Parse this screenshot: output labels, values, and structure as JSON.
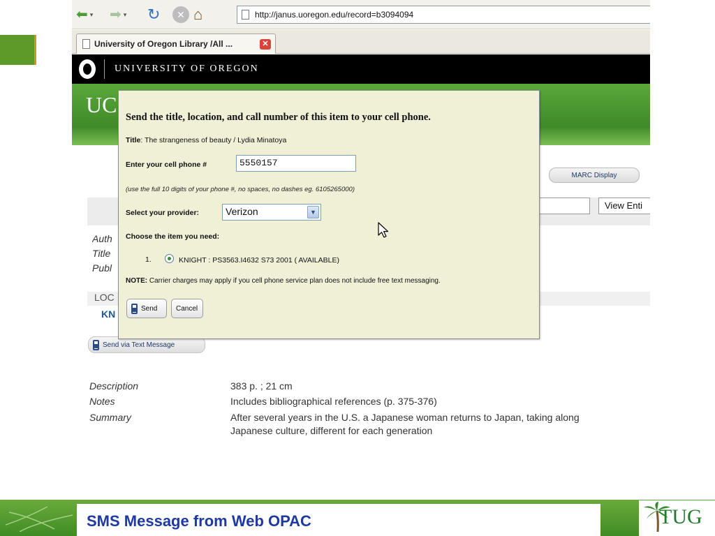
{
  "browser": {
    "url": "http://janus.uoregon.edu/record=b3094094",
    "tab_title": "University of Oregon Library /All ...",
    "tab_close_glyph": "✕",
    "back_glyph": "⬅",
    "forward_glyph": "➡",
    "dropdown_glyph": "▾",
    "refresh_glyph": "↻",
    "stop_glyph": "✕",
    "home_glyph": "⌂"
  },
  "site": {
    "university_name": "UNIVERSITY OF OREGON",
    "band_title_partial": "UC"
  },
  "record_page": {
    "marc_button": "MARC Display",
    "view_entire_button": "View Enti",
    "field_labels_partial": [
      "Auth",
      "Title",
      "Publ"
    ],
    "location_label_partial": "LOC",
    "location_value_partial": "KN",
    "send_text_button": "Send via Text Message",
    "details": [
      {
        "label": "Description",
        "value": "383 p. ; 21 cm"
      },
      {
        "label": "Notes",
        "value": "Includes bibliographical references (p. 375-376)"
      },
      {
        "label": "Summary",
        "value": "After several years in the U.S. a Japanese woman returns to Japan, taking along"
      },
      {
        "label": "",
        "value": "Japanese culture, different for each generation"
      }
    ]
  },
  "sms_dialog": {
    "heading": "Send the title, location, and call number of this item to your cell phone.",
    "title_label": "Title",
    "title_value": ": The strangeness of beauty / Lydia Minatoya",
    "phone_label": "Enter your cell phone #",
    "phone_value": "5550157",
    "phone_hint": "(use the full 10 digits of your phone #, no spaces, no dashes eg. 6105265000)",
    "provider_label": "Select your provider:",
    "provider_value": "Verizon",
    "select_arrow_glyph": "▼",
    "items_label": "Choose the item you need:",
    "item_number": "1.",
    "item_text": "KNIGHT : PS3563.I4632 S73 2001 ( AVAILABLE)",
    "note_label": "NOTE:",
    "note_text": " Carrier charges may apply if you cell phone service plan does not include free text messaging.",
    "send_button": "Send",
    "cancel_button": "Cancel"
  },
  "slide": {
    "footer_title": "SMS Message from Web OPAC",
    "footer_logo": "TUG",
    "colors": {
      "footer_green": "#4f9a2e",
      "title_blue": "#1e3aa0",
      "dialog_bg": "#f0f0d7",
      "uo_green": "#4a9a30"
    }
  }
}
